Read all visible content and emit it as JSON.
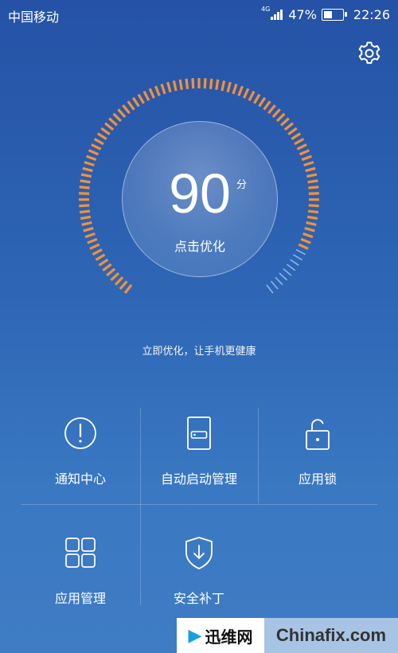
{
  "status_bar": {
    "carrier": "中国移动",
    "network": "4G",
    "signal_level": 4,
    "battery_percent": "47%",
    "battery_level": 0.47,
    "time": "22:26"
  },
  "score": {
    "value": "90",
    "unit": "分",
    "action": "点击优化",
    "gauge_fill": 0.9
  },
  "tagline": "立即优化，让手机更健康",
  "tiles": [
    {
      "label": "通知中心",
      "icon": "exclamation-circle-icon"
    },
    {
      "label": "自动启动管理",
      "icon": "device-card-icon"
    },
    {
      "label": "应用锁",
      "icon": "unlocked-padlock-icon"
    },
    {
      "label": "应用管理",
      "icon": "grid-squares-icon"
    },
    {
      "label": "安全补丁",
      "icon": "shield-download-icon"
    }
  ],
  "watermark": {
    "left_text": "迅维网",
    "right_text": "Chinafix.com"
  },
  "colors": {
    "background_top": "#2552a6",
    "background_bottom": "#3f7cc4",
    "gauge_active": "#f2913a",
    "gauge_inactive": "#9fc3ef"
  }
}
